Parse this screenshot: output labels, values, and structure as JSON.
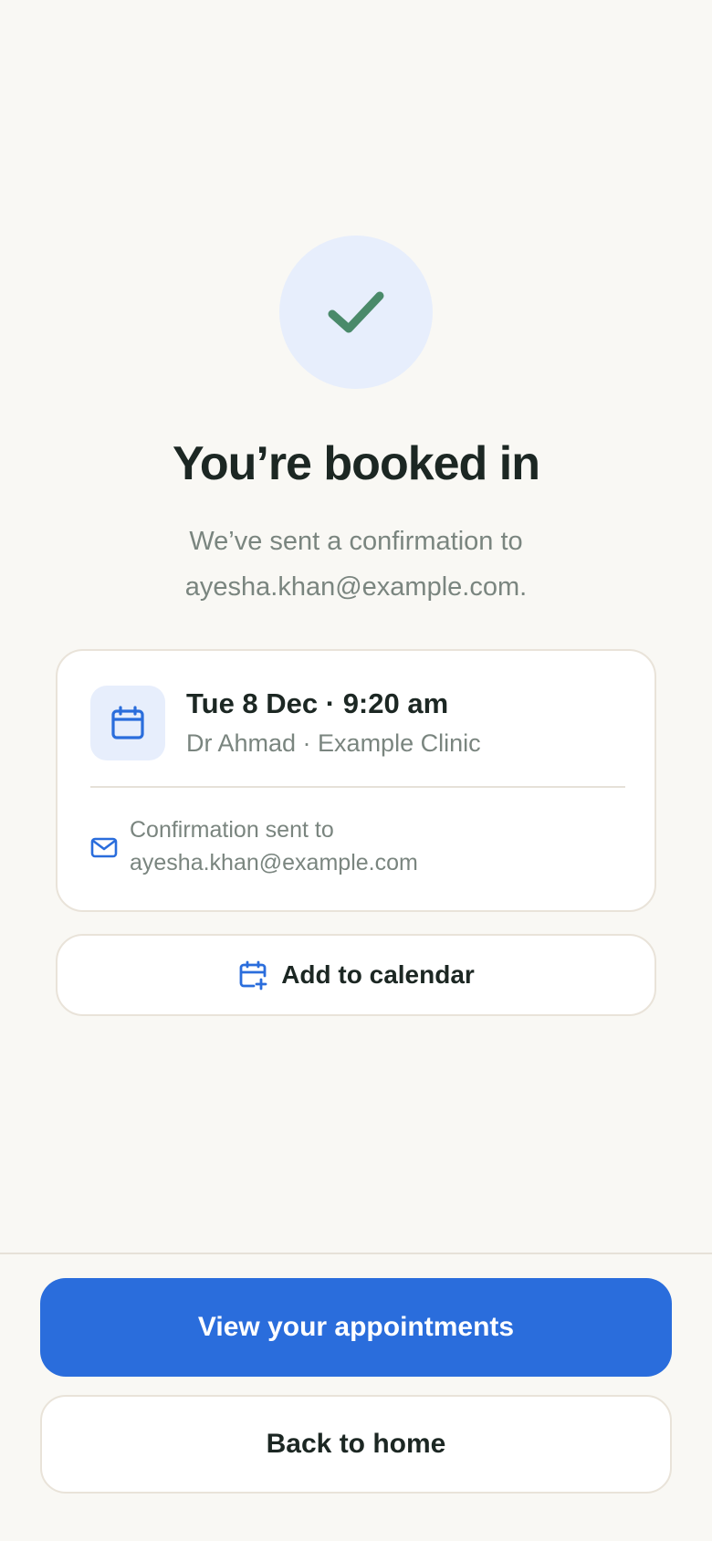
{
  "confirmation": {
    "title": "You’re booked in",
    "subtitle_line1": "We’ve sent a confirmation to",
    "subtitle_line2": "ayesha.khan@example.com."
  },
  "appointment_card": {
    "datetime": "Tue 8 Dec · 9:20 am",
    "doctor_clinic": "Dr Ahmad · Example Clinic",
    "confirmation_label": "Confirmation sent to",
    "confirmation_email": "ayesha.khan@example.com"
  },
  "actions": {
    "add_to_calendar": "Add to calendar",
    "view_appointments": "View your appointments",
    "back_home": "Back to home"
  },
  "icons": {
    "success": "check-icon",
    "calendar": "calendar-icon",
    "mail": "mail-icon",
    "calendar_add": "calendar-plus-icon"
  },
  "colors": {
    "background": "#f9f8f4",
    "accent": "#2a6ddc",
    "success": "#4a8a6a",
    "tile": "#e7eefc",
    "text_primary": "#1c2723",
    "text_muted": "#7a857f"
  }
}
